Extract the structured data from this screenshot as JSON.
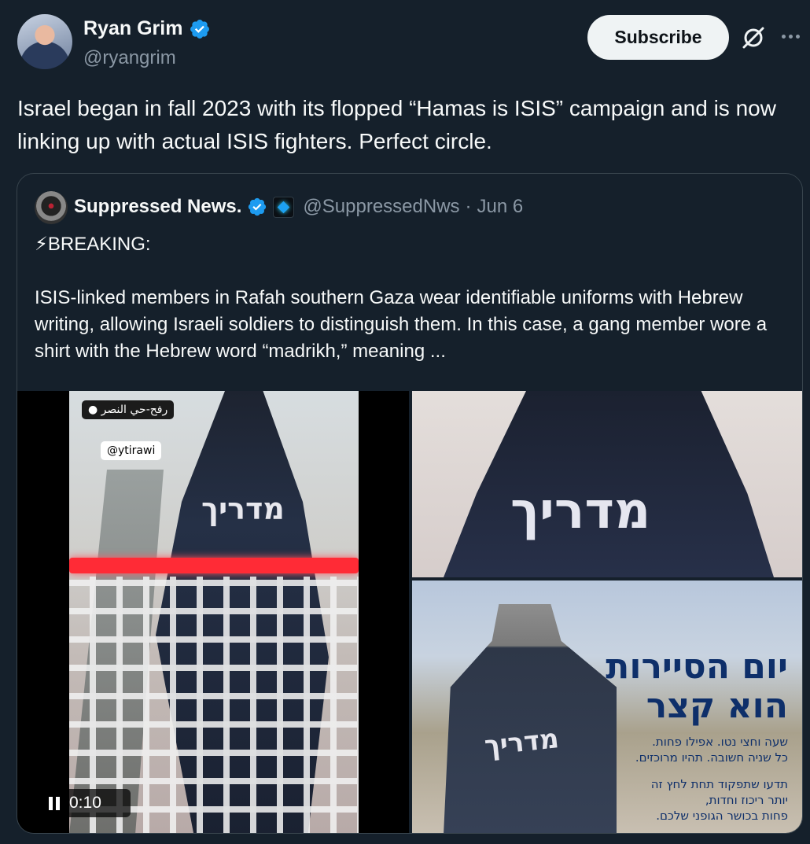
{
  "author": {
    "name": "Ryan Grim",
    "handle": "@ryangrim",
    "verified_color": "#1d9bf0"
  },
  "actions": {
    "subscribe_label": "Subscribe",
    "grok_icon": "grok-icon",
    "more_icon": "more-icon"
  },
  "tweet": {
    "text": "Israel began in fall 2023 with its flopped “Hamas is ISIS” campaign and is now linking up with actual ISIS fighters. Perfect circle."
  },
  "quote": {
    "name": "Suppressed News.",
    "handle": "@SuppressedNws",
    "separator": "·",
    "date": "Jun 6",
    "line1": "⚡BREAKING:",
    "line2": "ISIS-linked members in Rafah southern Gaza wear identifiable uniforms with Hebrew writing, allowing Israeli soldiers to distinguish them. In this case, a gang member wore a shirt with the Hebrew word “madrikh,” meaning ..."
  },
  "media": {
    "video": {
      "location_label": "رفح-حي النصر",
      "credit": "@ytirawi",
      "shirt_text": "מדריך",
      "time": "0:10"
    },
    "top_right": {
      "shirt_text": "מדריך"
    },
    "bottom_right": {
      "shirt_text": "מדריך",
      "headline_1": "יום הסיירות",
      "headline_2": "הוא קצר",
      "small_1": "שעה וחצי נטו. אפילו פחות.",
      "small_2": "כל שניה חשובה. תהיו מרוכזים.",
      "small_3": "תדעו שתפקוד תחת לחץ זה",
      "small_4": "יותר ריכוז וחדות,",
      "small_5": "פחות בכושר הגופני שלכם."
    }
  }
}
